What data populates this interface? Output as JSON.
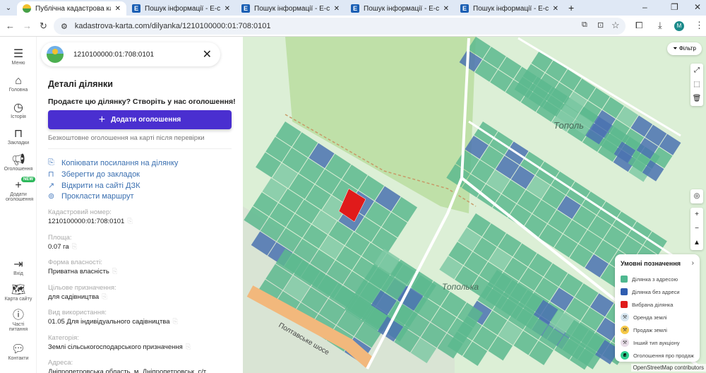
{
  "browser": {
    "tabs": [
      {
        "title": "Публічна кадастрова карта Ук",
        "active": true
      },
      {
        "title": "Пошук інформації - Е-сервіси"
      },
      {
        "title": "Пошук інформації - Е-сервіси"
      },
      {
        "title": "Пошук інформації - Е-сервіси"
      },
      {
        "title": "Пошук інформації - Е-сервіси"
      }
    ],
    "url": "kadastrova-karta.com/dilyanka/1210100000:01:708:0101",
    "avatar": "M"
  },
  "rail": {
    "items": [
      {
        "label": "Меню"
      },
      {
        "label": "Головна"
      },
      {
        "label": "Історія"
      },
      {
        "label": "Закладки"
      },
      {
        "label": "Оголошення"
      },
      {
        "label": "Додати оголошення",
        "badge": "NEW"
      },
      {
        "label": "Вхід"
      },
      {
        "label": "Карта сайту"
      },
      {
        "label": "Часті питання"
      },
      {
        "label": "Контакти"
      }
    ]
  },
  "panel": {
    "search_value": "1210100000:01:708:0101",
    "title": "Деталі ділянки",
    "promo": "Продаєте цю ділянку? Створіть у нас оголошення!",
    "add_button": "Додати оголошення",
    "note": "Безкоштовне оголошення на карті після перевірки",
    "links": [
      "Копіювати посилання на ділянку",
      "Зберегти до закладок",
      "Відкрити на сайті ДЗК",
      "Прокласти маршрут"
    ],
    "fields": [
      {
        "label": "Кадастровий номер:",
        "value": "1210100000:01:708:0101"
      },
      {
        "label": "Площа:",
        "value": "0.07 га"
      },
      {
        "label": "Форма власності:",
        "value": "Приватна власність"
      },
      {
        "label": "Цільове призначення:",
        "value": "для садівництва"
      },
      {
        "label": "Вид використання:",
        "value": "01.05 Для індивідуального садівництва"
      },
      {
        "label": "Категорія:",
        "value": "Землі сільськогосподарського призначення"
      },
      {
        "label": "Адреса:",
        "value": "Дніпропетровська область, м. Дніпропетровськ, с/т"
      }
    ]
  },
  "map": {
    "filter": "Фільтр",
    "labels": {
      "topol": "Тополь",
      "topolka": "Тополька",
      "road": "Полтавське шосе"
    },
    "attribution": "OpenStreetMap contributors",
    "colors": {
      "with_address": "#5cb88e",
      "no_address": "#4a72b0",
      "selected": "#e01b1b",
      "background": "#dcefd6",
      "forest": "#bfe0a8"
    },
    "legend": {
      "title": "Умовні позначення",
      "items": [
        "Ділянка з адресою",
        "Ділянка без адреси",
        "Вибрана ділянка",
        "Оренда землі",
        "Продаж землі",
        "Інший тип аукціону",
        "Оголошення про продаж"
      ]
    }
  }
}
